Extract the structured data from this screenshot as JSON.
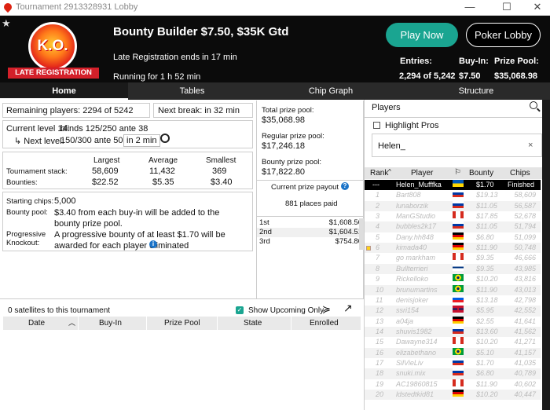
{
  "window": {
    "title": "Tournament 2913328931 Lobby",
    "minimize": "—",
    "maximize": "☐",
    "close": "✕"
  },
  "header": {
    "star": "★",
    "ko_logo": "K.O.",
    "late_reg_banner": "LATE REGISTRATION",
    "tournament_name": "Bounty Builder $7.50, $35K Gtd",
    "late_reg_text": "Late Registration ends in 17 min",
    "running_text": "Running for 1 h 52 min",
    "play_now": "Play Now",
    "poker_lobby": "Poker Lobby",
    "entries_label": "Entries:",
    "entries_value": "2,294 of 5,242",
    "buyin_label": "Buy-In:",
    "buyin_value": "$7.50",
    "prizepool_label": "Prize Pool:",
    "prizepool_value": "$35,068.98"
  },
  "tabs": [
    "Home",
    "Tables",
    "Chip Graph",
    "Structure"
  ],
  "info": {
    "remaining": "Remaining players: 2294 of 5242",
    "next_break": "Next break: in 32 min",
    "current_level_label": "Current level 14:",
    "current_level_value": "blinds 125/250 ante 38",
    "next_level_label": "↳ Next level:",
    "next_level_value": "150/300 ante 50",
    "next_level_time": "in 2 min",
    "stats_headers": [
      "Largest",
      "Average",
      "Smallest"
    ],
    "stack_label": "Tournament stack:",
    "stack_values": [
      "58,609",
      "11,432",
      "369"
    ],
    "bounties_label": "Bounties:",
    "bounties_values": [
      "$22.52",
      "$5.35",
      "$3.40"
    ],
    "starting_chips_label": "Starting chips:",
    "starting_chips_value": "5,000",
    "bounty_pool_label": "Bounty pool:",
    "bounty_pool_text": "$3.40 from each buy-in will be added to the bounty prize pool.",
    "pko_label1": "Progressive",
    "pko_label2": "Knockout:",
    "pko_text": "A progressive bounty of at least $1.70 will be awarded for each player eliminated"
  },
  "prize": {
    "total_label": "Total prize pool:",
    "total_value": "$35,068.98",
    "regular_label": "Regular prize pool:",
    "regular_value": "$17,246.18",
    "bounty_label": "Bounty prize pool:",
    "bounty_value": "$17,822.80",
    "payout_title": "Current prize payout",
    "places_paid": "881 places paid",
    "payouts": [
      {
        "place": "1st",
        "amount": "$1,608.50"
      },
      {
        "place": "2nd",
        "amount": "$1,604.51"
      },
      {
        "place": "3rd",
        "amount": "$754.80"
      }
    ]
  },
  "satellites": {
    "count_text": "0 satellites to this tournament",
    "show_upcoming": "Show Upcoming Only",
    "columns": [
      "Date",
      "Buy-In",
      "Prize Pool",
      "State",
      "Enrolled"
    ]
  },
  "players": {
    "title": "Players",
    "highlight_pros": "Highlight Pros",
    "search_value": "Helen_",
    "clear": "×",
    "columns": [
      "Rank",
      "Player",
      "",
      "Bounty",
      "Chips"
    ],
    "rows": [
      {
        "rank": "---",
        "name": "Helen_Mufffka",
        "flag": "ua",
        "bounty": "$1.70",
        "chips": "Finished"
      },
      {
        "rank": "1",
        "name": "Bart808",
        "flag": "ru",
        "bounty": "$19.13",
        "chips": "58,609"
      },
      {
        "rank": "2",
        "name": "lunaborzik",
        "flag": "ru",
        "bounty": "$11.05",
        "chips": "56,587"
      },
      {
        "rank": "3",
        "name": "ManGStudio",
        "flag": "ca",
        "bounty": "$17.85",
        "chips": "52,678"
      },
      {
        "rank": "4",
        "name": "bubbles2k17",
        "flag": "ru",
        "bounty": "$11.05",
        "chips": "51,794"
      },
      {
        "rank": "5",
        "name": "Dany.hh848",
        "flag": "de",
        "bounty": "$6.80",
        "chips": "51,099"
      },
      {
        "rank": "6",
        "name": "kimada40",
        "flag": "de",
        "bounty": "$11.90",
        "chips": "50,748"
      },
      {
        "rank": "7",
        "name": "go markham",
        "flag": "ca",
        "bounty": "$9.35",
        "chips": "46,666"
      },
      {
        "rank": "8",
        "name": "Bullterrieri",
        "flag": "fi",
        "bounty": "$9.35",
        "chips": "43,985"
      },
      {
        "rank": "9",
        "name": "Rickelloko",
        "flag": "br",
        "bounty": "$10.20",
        "chips": "43,816"
      },
      {
        "rank": "10",
        "name": "brunumartins",
        "flag": "br",
        "bounty": "$11.90",
        "chips": "43,013"
      },
      {
        "rank": "11",
        "name": "denisjoker",
        "flag": "si",
        "bounty": "$13.18",
        "chips": "42,798"
      },
      {
        "rank": "12",
        "name": "ssri154",
        "flag": "gb",
        "bounty": "$5.95",
        "chips": "42,552"
      },
      {
        "rank": "13",
        "name": "a04ja",
        "flag": "de",
        "bounty": "$2.55",
        "chips": "41,641"
      },
      {
        "rank": "14",
        "name": "shuvis1982",
        "flag": "ru",
        "bounty": "$13.60",
        "chips": "41,562"
      },
      {
        "rank": "15",
        "name": "Dawayne314",
        "flag": "ca",
        "bounty": "$10.20",
        "chips": "41,271"
      },
      {
        "rank": "16",
        "name": "elizabethano",
        "flag": "br",
        "bounty": "$5.10",
        "chips": "41,157"
      },
      {
        "rank": "17",
        "name": "SilVieLiv",
        "flag": "ru",
        "bounty": "$1.70",
        "chips": "41,035"
      },
      {
        "rank": "18",
        "name": "snuki.mix",
        "flag": "ru",
        "bounty": "$6.80",
        "chips": "40,789"
      },
      {
        "rank": "19",
        "name": "AC19860815",
        "flag": "ca",
        "bounty": "$11.90",
        "chips": "40,602"
      },
      {
        "rank": "20",
        "name": "ldstedtkid81",
        "flag": "de",
        "bounty": "$10.20",
        "chips": "40,447"
      }
    ]
  },
  "colors": {
    "accent": "#1aa591",
    "brand_red": "#d4202a",
    "header_bg": "#0b0b0b"
  }
}
